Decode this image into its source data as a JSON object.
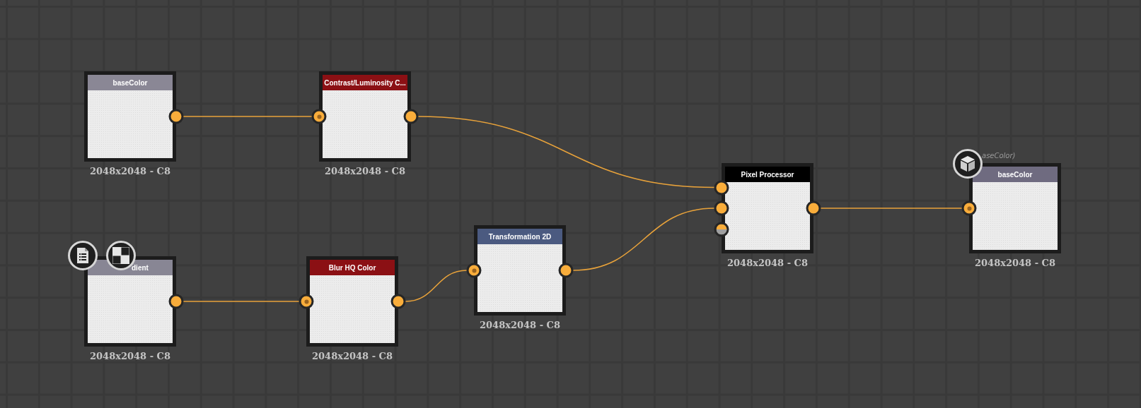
{
  "nodes": [
    {
      "title": "baseColor",
      "color": "#8a8795",
      "label": "2048x2048 - C8",
      "ports": [
        {
          "kind": "output"
        }
      ]
    },
    {
      "title": "Contrast/Luminosity C...",
      "color": "#8b1014",
      "label": "2048x2048 - C8",
      "ports": [
        {
          "kind": "input-dot"
        },
        {
          "kind": "output"
        }
      ]
    },
    {
      "title": "dient",
      "color": "#888694",
      "label": "2048x2048 - C8",
      "ports": [
        {
          "kind": "output"
        }
      ],
      "badges": [
        {
          "kind": "document"
        },
        {
          "kind": "checker"
        }
      ]
    },
    {
      "title": "Blur HQ Color",
      "color": "#8b1014",
      "label": "2048x2048 - C8",
      "ports": [
        {
          "kind": "input-dot"
        },
        {
          "kind": "output"
        }
      ]
    },
    {
      "title": "Transformation 2D",
      "color": "#4b5a80",
      "label": "2048x2048 - C8",
      "ports": [
        {
          "kind": "input-dot"
        },
        {
          "kind": "output"
        }
      ]
    },
    {
      "title": "Pixel Processor",
      "color": "#000000",
      "label": "2048x2048 - C8",
      "ports": [
        {
          "kind": "input"
        },
        {
          "kind": "input"
        },
        {
          "kind": "input-half"
        },
        {
          "kind": "output"
        }
      ]
    },
    {
      "title": "baseColor",
      "color": "#6f6b80",
      "label": "2048x2048 - C8",
      "caption": "aseColor)",
      "ports": [
        {
          "kind": "input-dot"
        }
      ],
      "badges": [
        {
          "kind": "cube"
        }
      ]
    }
  ]
}
